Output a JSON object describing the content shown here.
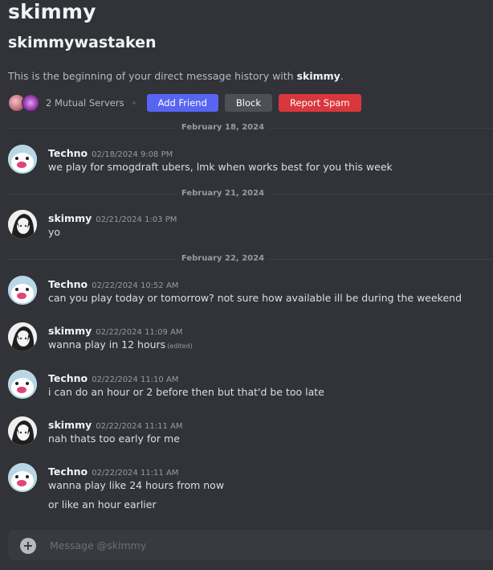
{
  "header": {
    "display_name": "skimmy",
    "username": "skimmywastaken",
    "intro_prefix": "This is the beginning of your direct message history with ",
    "intro_name": "skimmy",
    "intro_suffix": ".",
    "mutual_servers": "2 Mutual Servers",
    "add_friend_label": "Add Friend",
    "block_label": "Block",
    "report_spam_label": "Report Spam"
  },
  "dividers": [
    "February 18, 2024",
    "February 21, 2024",
    "February 22, 2024"
  ],
  "messages": [
    {
      "author": "Techno",
      "timestamp": "02/18/2024 9:08 PM",
      "lines": [
        "we play for smogdraft ubers, lmk when works best for you this week"
      ]
    },
    {
      "author": "skimmy",
      "timestamp": "02/21/2024 1:03 PM",
      "lines": [
        "yo"
      ]
    },
    {
      "author": "Techno",
      "timestamp": "02/22/2024 10:52 AM",
      "lines": [
        "can you play today or tomorrow? not sure how available ill be during the weekend"
      ]
    },
    {
      "author": "skimmy",
      "timestamp": "02/22/2024 11:09 AM",
      "lines": [
        "wanna play in 12 hours"
      ],
      "edited": "(edited)"
    },
    {
      "author": "Techno",
      "timestamp": "02/22/2024 11:10 AM",
      "lines": [
        "i can do an hour or 2 before then but that'd be too late"
      ]
    },
    {
      "author": "skimmy",
      "timestamp": "02/22/2024 11:11 AM",
      "lines": [
        "nah thats too early for me"
      ]
    },
    {
      "author": "Techno",
      "timestamp": "02/22/2024 11:11 AM",
      "lines": [
        "wanna play like 24 hours from now",
        "or like an hour earlier"
      ]
    }
  ],
  "composer": {
    "placeholder": "Message @skimmy"
  },
  "colors": {
    "background": "#313338",
    "blurple": "#5865f2",
    "danger": "#da373c",
    "secondary": "#4e5058"
  }
}
